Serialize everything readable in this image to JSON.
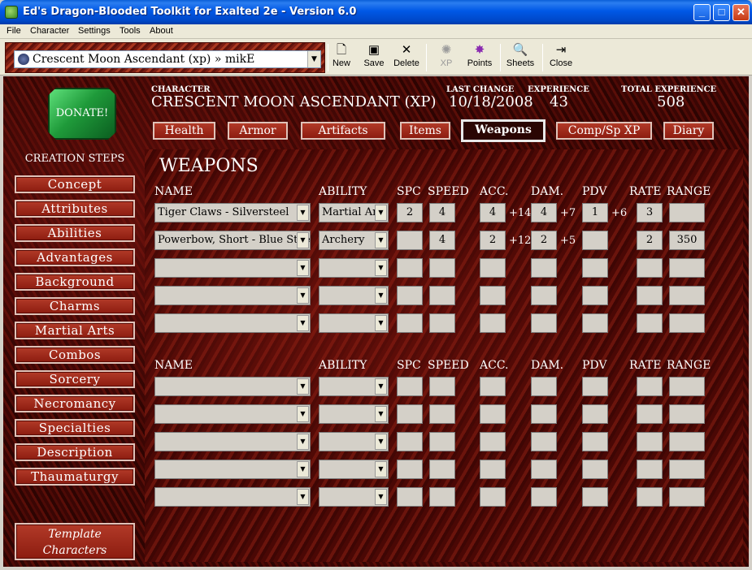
{
  "window": {
    "title": "Ed's Dragon-Blooded Toolkit for Exalted 2e - Version 6.0"
  },
  "menu": [
    "File",
    "Character",
    "Settings",
    "Tools",
    "About"
  ],
  "toolbar": {
    "character_selector": "Crescent Moon Ascendant (xp) » mikE",
    "buttons": [
      {
        "label": "New",
        "icon": "new-document-icon"
      },
      {
        "label": "Save",
        "icon": "floppy-disk-icon"
      },
      {
        "label": "Delete",
        "icon": "delete-x-icon"
      },
      {
        "label": "XP",
        "icon": "xp-icon",
        "disabled": true
      },
      {
        "label": "Points",
        "icon": "points-icon"
      },
      {
        "label": "Sheets",
        "icon": "sheets-icon"
      },
      {
        "label": "Close",
        "icon": "close-door-icon"
      }
    ]
  },
  "donate": {
    "label": "DONATE!"
  },
  "creation_steps": {
    "title": "CREATION STEPS",
    "items": [
      "Concept",
      "Attributes",
      "Abilities",
      "Advantages",
      "Background",
      "Charms",
      "Martial Arts",
      "Combos",
      "Sorcery",
      "Necromancy",
      "Specialties",
      "Description",
      "Thaumaturgy"
    ],
    "template_label": "Template Characters"
  },
  "header": {
    "character_label": "CHARACTER",
    "character_value": "CRESCENT MOON ASCENDANT (XP)",
    "last_change_label": "LAST CHANGE",
    "last_change_value": "10/18/2008",
    "experience_label": "EXPERIENCE",
    "experience_value": "43",
    "total_experience_label": "TOTAL EXPERIENCE",
    "total_experience_value": "508"
  },
  "tabs": [
    "Health",
    "Armor",
    "Artifacts",
    "Items",
    "Weapons",
    "Comp/Sp XP",
    "Diary"
  ],
  "active_tab": "Weapons",
  "weapons": {
    "title": "WEAPONS",
    "columns": [
      "NAME",
      "ABILITY",
      "SPC",
      "SPEED",
      "ACC.",
      "DAM.",
      "PDV",
      "RATE",
      "RANGE"
    ],
    "section1": [
      {
        "name": "Tiger Claws - Silversteel",
        "ability": "Martial Arts",
        "spc": "2",
        "speed": "4",
        "acc": "4",
        "acc_mod": "+14",
        "dam": "4",
        "dam_mod": "+7",
        "pdv": "1",
        "pdv_mod": "+6",
        "rate": "3",
        "range": ""
      },
      {
        "name": "Powerbow, Short - Blue Steel",
        "ability": "Archery",
        "spc": "",
        "speed": "4",
        "acc": "2",
        "acc_mod": "+12",
        "dam": "2",
        "dam_mod": "+5",
        "pdv": "",
        "pdv_mod": "",
        "rate": "2",
        "range": "350"
      },
      {
        "name": "",
        "ability": "",
        "spc": "",
        "speed": "",
        "acc": "",
        "acc_mod": "",
        "dam": "",
        "dam_mod": "",
        "pdv": "",
        "pdv_mod": "",
        "rate": "",
        "range": ""
      },
      {
        "name": "",
        "ability": "",
        "spc": "",
        "speed": "",
        "acc": "",
        "acc_mod": "",
        "dam": "",
        "dam_mod": "",
        "pdv": "",
        "pdv_mod": "",
        "rate": "",
        "range": ""
      },
      {
        "name": "",
        "ability": "",
        "spc": "",
        "speed": "",
        "acc": "",
        "acc_mod": "",
        "dam": "",
        "dam_mod": "",
        "pdv": "",
        "pdv_mod": "",
        "rate": "",
        "range": ""
      }
    ],
    "section2": [
      {
        "name": "",
        "ability": "",
        "spc": "",
        "speed": "",
        "acc": "",
        "acc_mod": "",
        "dam": "",
        "dam_mod": "",
        "pdv": "",
        "pdv_mod": "",
        "rate": "",
        "range": ""
      },
      {
        "name": "",
        "ability": "",
        "spc": "",
        "speed": "",
        "acc": "",
        "acc_mod": "",
        "dam": "",
        "dam_mod": "",
        "pdv": "",
        "pdv_mod": "",
        "rate": "",
        "range": ""
      },
      {
        "name": "",
        "ability": "",
        "spc": "",
        "speed": "",
        "acc": "",
        "acc_mod": "",
        "dam": "",
        "dam_mod": "",
        "pdv": "",
        "pdv_mod": "",
        "rate": "",
        "range": ""
      },
      {
        "name": "",
        "ability": "",
        "spc": "",
        "speed": "",
        "acc": "",
        "acc_mod": "",
        "dam": "",
        "dam_mod": "",
        "pdv": "",
        "pdv_mod": "",
        "rate": "",
        "range": ""
      },
      {
        "name": "",
        "ability": "",
        "spc": "",
        "speed": "",
        "acc": "",
        "acc_mod": "",
        "dam": "",
        "dam_mod": "",
        "pdv": "",
        "pdv_mod": "",
        "rate": "",
        "range": ""
      }
    ]
  }
}
